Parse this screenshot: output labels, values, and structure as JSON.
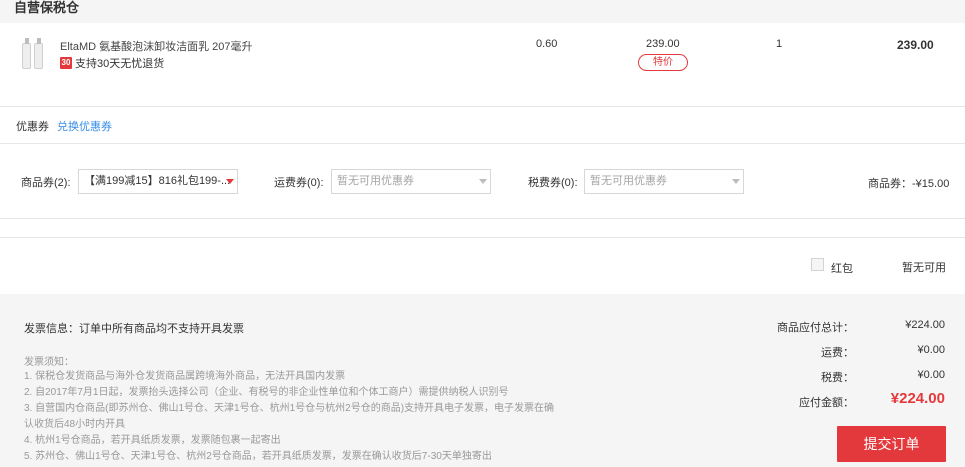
{
  "warehouse": {
    "title": "自营保税仓"
  },
  "product": {
    "name": "EltaMD 氨基酸泡沫卸妆洁面乳 207毫升",
    "return_badge": "30",
    "return_text": "支持30天无忧退货",
    "weight": "0.60",
    "unit_price": "239.00",
    "special_tag": "特价",
    "quantity": "1",
    "total": "239.00",
    "thumbnail_icon": "product-bottles-icon"
  },
  "coupons": {
    "header": "优惠券",
    "exchange_link": "兑换优惠券",
    "goods_label": "商品券(2):",
    "goods_selected": "【满199减15】816礼包199-...",
    "shipping_label": "运费券(0):",
    "shipping_placeholder": "暂无可用优惠券",
    "tax_label": "税费券(0):",
    "tax_placeholder": "暂无可用优惠券",
    "discount_text": "商品券：-¥15.00"
  },
  "red_packet": {
    "label": "红包",
    "status": "暂无可用"
  },
  "invoice": {
    "info": "发票信息：订单中所有商品均不支持开具发票",
    "notice_title": "发票须知：",
    "notice_lines": [
      "1. 保税仓发货商品与海外仓发货商品属跨境海外商品，无法开具国内发票",
      "2. 自2017年7月1日起，发票抬头选择公司（企业、有税号的非企业性单位和个体工商户）需提供纳税人识别号",
      "3. 自营国内仓商品(即苏州仓、佛山1号仓、天津1号仓、杭州1号仓与杭州2号仓的商品)支持开具电子发票，电子发票在确",
      "认收货后48小时内开具",
      "4. 杭州1号仓商品，若开具纸质发票，发票随包裹一起寄出",
      "5. 苏州仓、佛山1号仓、天津1号仓、杭州2号仓商品，若开具纸质发票，发票在确认收货后7-30天单独寄出"
    ]
  },
  "summary": {
    "goods_total_label": "商品应付总计：",
    "goods_total_value": "¥224.00",
    "shipping_label": "运费：",
    "shipping_value": "¥0.00",
    "tax_label": "税费：",
    "tax_value": "¥0.00",
    "payable_label": "应付金额：",
    "payable_value": "¥224.00",
    "submit_label": "提交订单"
  },
  "colors": {
    "accent": "#e4393c",
    "link": "#3a8ee6",
    "panel": "#f5f5f5"
  }
}
